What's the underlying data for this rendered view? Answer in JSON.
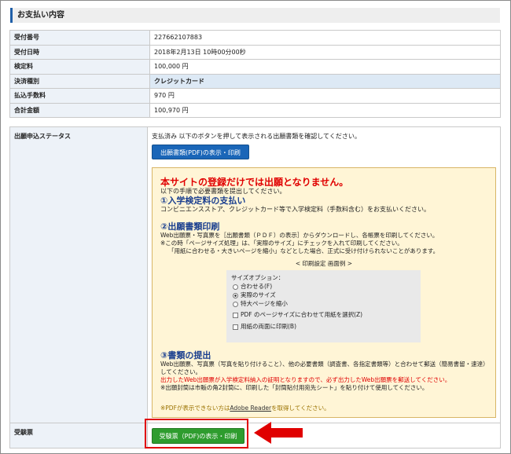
{
  "section_title": "お支払い内容",
  "payment_rows": [
    {
      "label": "受付番号",
      "value": "227662107883"
    },
    {
      "label": "受付日時",
      "value": "2018年2月13日 10時00分00秒"
    },
    {
      "label": "検定料",
      "value": "100,000 円"
    },
    {
      "label": "決済種別",
      "value": "クレジットカード"
    },
    {
      "label": "払込手数料",
      "value": "970 円"
    },
    {
      "label": "合計金額",
      "value": "100,970 円"
    }
  ],
  "status": {
    "label": "出願申込ステータス",
    "text": "支払済み 以下のボタンを押して表示される出願書類を確認してください。",
    "button": "出願書類(PDF)の表示・印刷"
  },
  "notice": {
    "warning": "本サイトの登録だけでは出願となりません。",
    "intro": "以下の手順で必要書類を提出してください。",
    "step1_title": "①入学検定料の支払い",
    "step1_text": "コンビニエンスストア、クレジットカード等で入学検定料（手数料含む）をお支払いください。",
    "step2_title": "②出願書類印刷",
    "step2_line1": "Web出願票・写真票を［出願書類（ＰＤＦ）の表示］からダウンロードし、各帳票を印刷してください。",
    "step2_line2": "※この時「ページサイズ処理」は、「実際のサイズ」にチェックを入れて印刷してください。",
    "step2_line3": "「用紙に合わせる・大きいページを縮小」などとした場合、正式に受け付けられないことがあります。",
    "print_example_title": "< 印刷設定 画面例 >",
    "print_options": {
      "title": "サイズオプション：",
      "fit": "合わせる(F)",
      "actual": "実際のサイズ",
      "shrink": "特大ページを縮小",
      "pdf_size": "PDF のページサイズに合わせて用紙を選択(Z)",
      "duplex": "用紙の両面に印刷(B)"
    },
    "step3_title": "③書類の提出",
    "step3_line1": "Web出願票、写真票（写真を貼り付けること）、他の必要書類（調査書、各指定書類等）と合わせて郵送（簡易書留・速達）してください。",
    "step3_red": "出力したWeb出願票が入学検定料納入の証明となりますので、必ず出力したWeb出願票を郵送してください。",
    "step3_line2": "※出願封筒は市販の角2封筒に、印刷した「封筒貼付用宛先シート」を貼り付けて使用してください。",
    "pdf_note_prefix": "※PDFが表示できない方は",
    "pdf_note_link": "Adobe Reader",
    "pdf_note_suffix": "を取得してください。"
  },
  "exam_ticket": {
    "label": "受験票",
    "button": "受験票（PDF)の表示・印刷"
  },
  "colors": {
    "accent": "#1f5fa8",
    "warning": "#e00000",
    "green": "#2e9c2e",
    "notice_bg": "#fff5d6"
  }
}
